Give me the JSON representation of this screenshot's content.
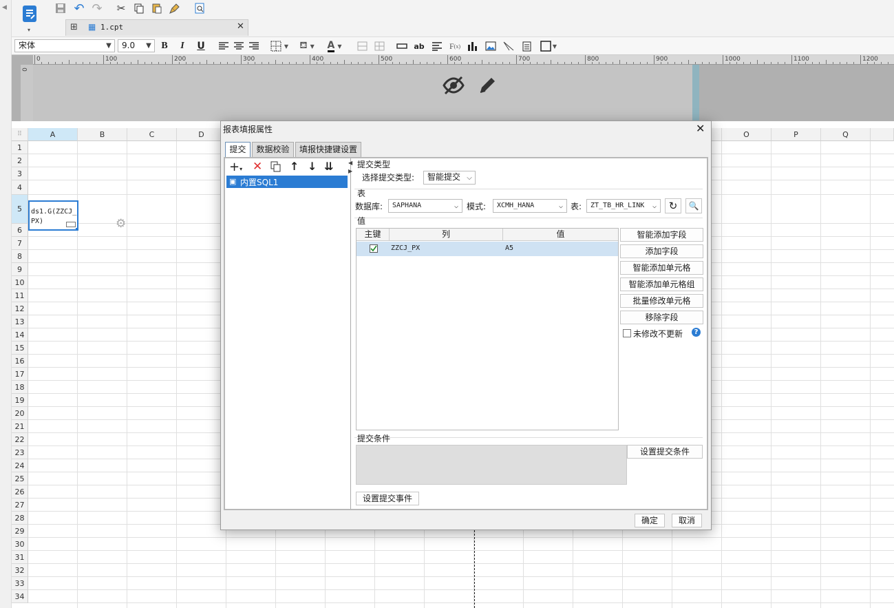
{
  "app": {
    "tab_title": "1.cpt"
  },
  "format": {
    "font_name": "宋体",
    "font_size": "9.0",
    "bold": "B",
    "italic": "I",
    "underline": "U",
    "ab_label": "ab"
  },
  "ruler": {
    "ticks": [
      "0",
      "100",
      "200",
      "300",
      "400",
      "500",
      "600",
      "700",
      "800",
      "900",
      "1000",
      "1100",
      "1200"
    ],
    "vzero": "0"
  },
  "sheet": {
    "columns": [
      "A",
      "B",
      "C",
      "D",
      "",
      "",
      "",
      "",
      "",
      "",
      "",
      "",
      "",
      "",
      "O",
      "P",
      "Q"
    ],
    "rows": [
      "1",
      "2",
      "3",
      "4",
      "5",
      "6",
      "7",
      "8",
      "9",
      "10",
      "11",
      "12",
      "13",
      "14",
      "15",
      "16",
      "17",
      "18",
      "19",
      "20",
      "21",
      "22",
      "23",
      "24",
      "25",
      "26",
      "27",
      "28",
      "29",
      "30",
      "31",
      "32",
      "33",
      "34"
    ],
    "cell_a5": "ds1.G(ZZCJ_PX)"
  },
  "dialog": {
    "title": "报表填报属性",
    "tabs": [
      "提交",
      "数据校验",
      "填报快捷键设置"
    ],
    "submit_list": [
      "内置SQL1"
    ],
    "submit_type_section": "提交类型",
    "submit_type_label": "选择提交类型:",
    "submit_type_value": "智能提交",
    "table_section": "表",
    "db_label": "数据库:",
    "db_value": "SAPHANA",
    "schema_label": "模式:",
    "schema_value": "XCMH_HANA",
    "table_label": "表:",
    "table_value": "ZT_TB_HR_LINK",
    "value_section": "值",
    "grid_headers": [
      "主键",
      "列",
      "值"
    ],
    "grid_rows": [
      {
        "key": true,
        "column": "ZZCJ_PX",
        "value": "A5"
      }
    ],
    "side_buttons": [
      "智能添加字段",
      "添加字段",
      "智能添加单元格",
      "智能添加单元格组",
      "批量修改单元格",
      "移除字段"
    ],
    "no_update_label": "未修改不更新",
    "condition_section": "提交条件",
    "set_condition_btn": "设置提交条件",
    "set_event_btn": "设置提交事件",
    "ok": "确定",
    "cancel": "取消"
  },
  "colors": {
    "accent": "#2b7cd3",
    "selection": "#cfe2f3",
    "delete_red": "#e03030"
  }
}
